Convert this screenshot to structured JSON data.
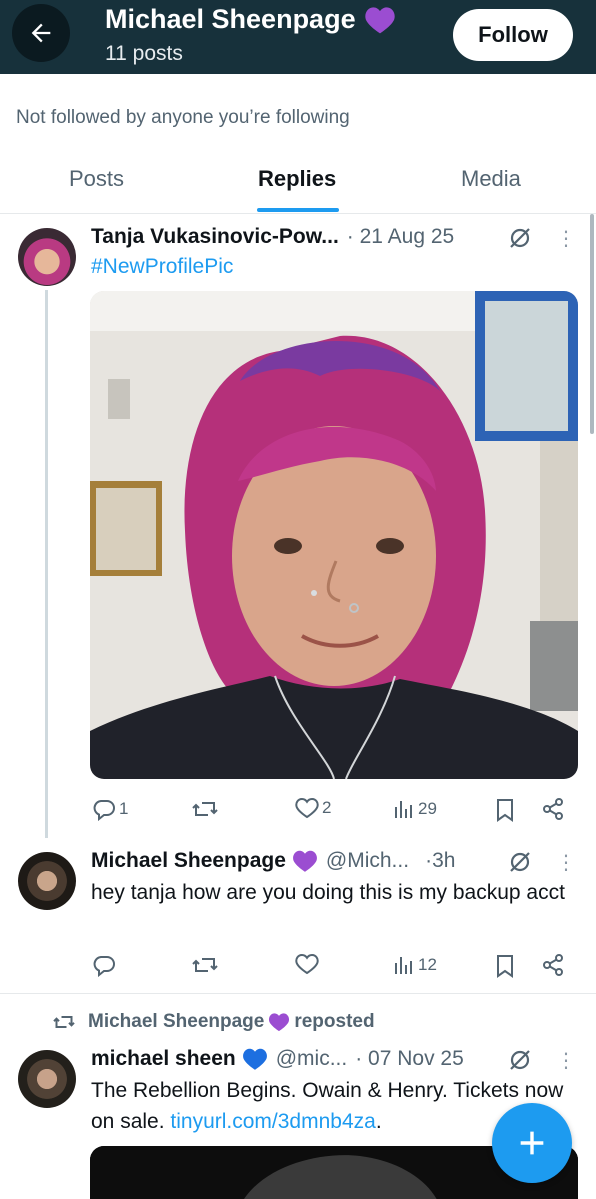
{
  "header": {
    "title": "Michael Sheenpage",
    "posts_count": "11 posts",
    "follow_label": "Follow"
  },
  "notice": "Not followed by anyone you’re following",
  "tabs": [
    {
      "label": "Posts",
      "active": false
    },
    {
      "label": "Replies",
      "active": true
    },
    {
      "label": "Media",
      "active": false
    }
  ],
  "posts": [
    {
      "name": "Tanja Vukasinovic-Pow...",
      "date": "· 21 Aug 25",
      "hashtag": "#NewProfilePic",
      "replies": "1",
      "reposts": "",
      "likes": "2",
      "views": "29"
    },
    {
      "name": "Michael Sheenpage",
      "handle": "@Mich...",
      "date": "·3h",
      "text": "hey tanja how are you doing this is my backup acct",
      "replies": "",
      "reposts": "",
      "likes": "",
      "views": "12"
    },
    {
      "repost_by": "Michael Sheenpage",
      "repost_label": "reposted",
      "name": "michael sheen",
      "handle": "@mic...",
      "date": "· 07 Nov 25",
      "text": "The Rebellion Begins. Owain & Henry. Tickets now on sale. ",
      "link": "tinyurl.com/3dmnb4za",
      "text_end": "."
    }
  ],
  "colors": {
    "header_bg": "#17313b",
    "accent": "#1d9bf0",
    "purple_heart": "#9b4dd1",
    "blue_heart": "#1d6fe0"
  },
  "icons": [
    "back-arrow-icon",
    "purple-heart-icon",
    "blue-heart-icon",
    "grok-icon",
    "more-icon",
    "reply-icon",
    "repost-icon",
    "like-icon",
    "views-icon",
    "bookmark-icon",
    "share-icon",
    "compose-plus-icon"
  ]
}
